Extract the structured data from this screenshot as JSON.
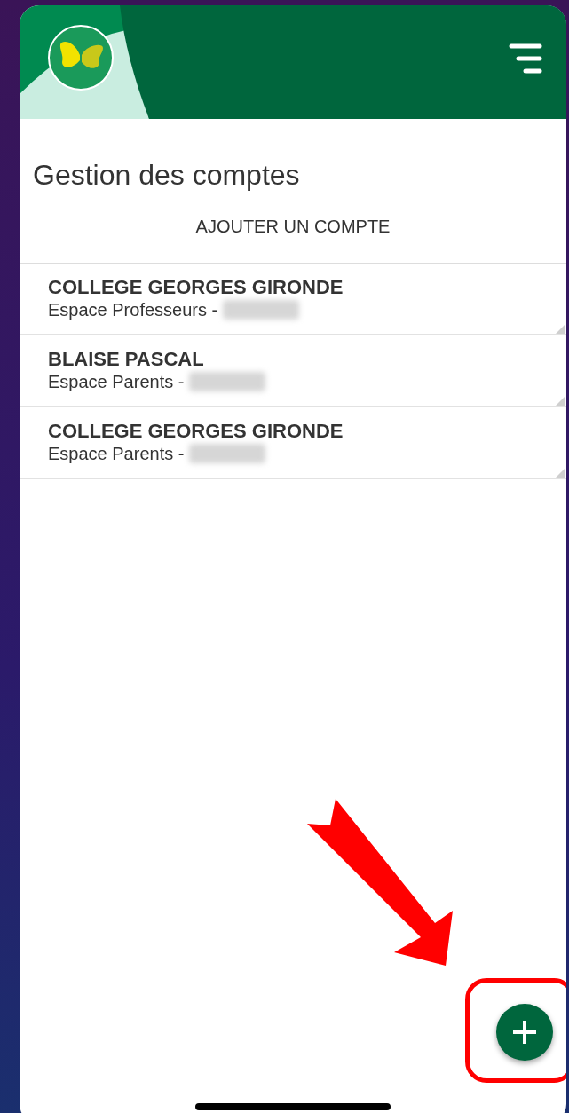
{
  "header": {
    "menu": true
  },
  "page_title": "Gestion des comptes",
  "add_account_link": "AJOUTER UN COMPTE",
  "accounts": [
    {
      "school": "COLLEGE GEORGES GIRONDE",
      "space": "Espace Professeurs -",
      "redacted": true
    },
    {
      "school": "BLAISE PASCAL",
      "space": "Espace Parents -",
      "redacted": true
    },
    {
      "school": "COLLEGE GEORGES GIRONDE",
      "space": "Espace Parents -",
      "redacted": true
    }
  ],
  "fab": {
    "highlighted": true,
    "pointer_arrow": true
  }
}
